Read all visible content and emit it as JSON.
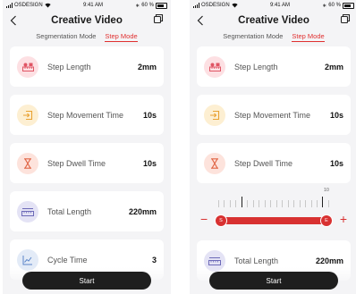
{
  "status": {
    "carrier": "OSDESIGN",
    "time": "9:41 AM",
    "battery": "60 %"
  },
  "nav": {
    "title": "Creative Video"
  },
  "tabs": {
    "segmentation": "Segmentation Mode",
    "step": "Step Mode"
  },
  "items": [
    {
      "label": "Step Length",
      "value": "2mm",
      "icon": "ruler-icon"
    },
    {
      "label": "Step Movement Time",
      "value": "10s",
      "icon": "move-in-icon"
    },
    {
      "label": "Step Dwell Time",
      "value": "10s",
      "icon": "hourglass-icon"
    },
    {
      "label": "Total Length",
      "value": "220mm",
      "icon": "length-icon"
    },
    {
      "label": "Cycle Time",
      "value": "3",
      "icon": "chart-icon"
    }
  ],
  "slider": {
    "tick_label": "10",
    "start_handle": "S",
    "end_handle": "E",
    "minus": "−",
    "plus": "+"
  },
  "start_button": "Start",
  "colors": {
    "accent": "#e03030",
    "button": "#1e1e1e",
    "background": "#f4f4f6"
  }
}
